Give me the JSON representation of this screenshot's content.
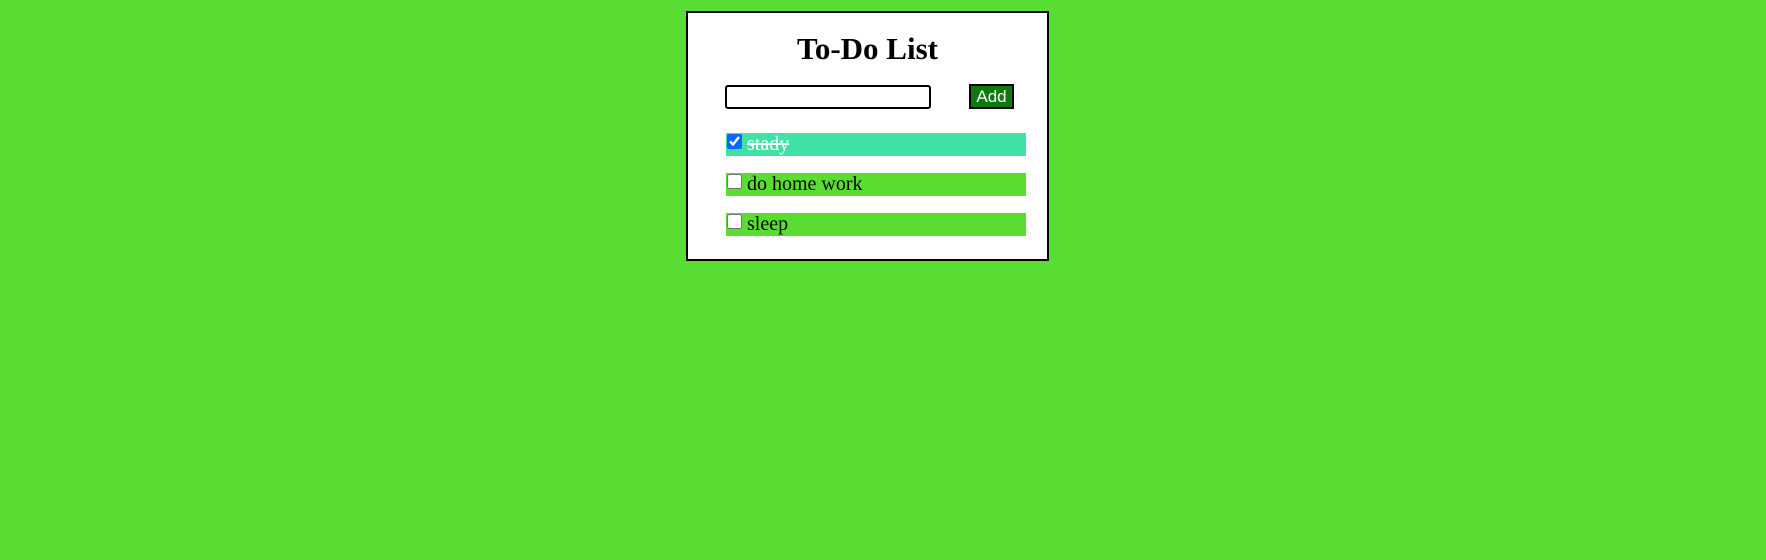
{
  "app": {
    "title": "To-Do List"
  },
  "form": {
    "input_value": "",
    "input_placeholder": "",
    "add_label": "Add"
  },
  "todos": [
    {
      "label": "stady",
      "done": true
    },
    {
      "label": "do home work",
      "done": false
    },
    {
      "label": "sleep",
      "done": false
    }
  ],
  "colors": {
    "page_background": "#59dd33",
    "item_background": "#59dd33",
    "done_item_background": "#3de2a4",
    "add_button_background": "#0c7a0c"
  }
}
